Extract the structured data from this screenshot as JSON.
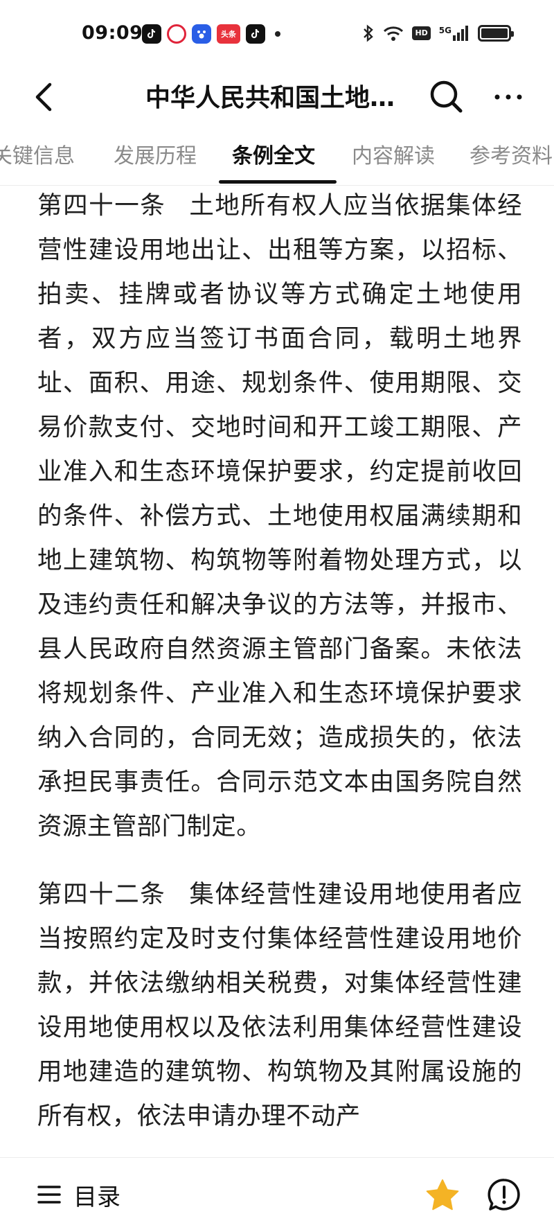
{
  "status_bar": {
    "time": "09:09",
    "toutiao_label": "头条",
    "hd_label": "HD",
    "network_label": "5G"
  },
  "header": {
    "title": "中华人民共和国土地…"
  },
  "tabs": [
    {
      "label": "关键信息",
      "active": false
    },
    {
      "label": "发展历程",
      "active": false
    },
    {
      "label": "条例全文",
      "active": true
    },
    {
      "label": "内容解读",
      "active": false
    },
    {
      "label": "参考资料",
      "active": false
    }
  ],
  "articles": [
    {
      "number": "第四十一条",
      "text": "土地所有权人应当依据集体经营性建设用地出让、出租等方案，以招标、拍卖、挂牌或者协议等方式确定土地使用者，双方应当签订书面合同，载明土地界址、面积、用途、规划条件、使用期限、交易价款支付、交地时间和开工竣工期限、产业准入和生态环境保护要求，约定提前收回的条件、补偿方式、土地使用权届满续期和地上建筑物、构筑物等附着物处理方式，以及违约责任和解决争议的方法等，并报市、县人民政府自然资源主管部门备案。未依法将规划条件、产业准入和生态环境保护要求纳入合同的，合同无效；造成损失的，依法承担民事责任。合同示范文本由国务院自然资源主管部门制定。"
    },
    {
      "number": "第四十二条",
      "text": "集体经营性建设用地使用者应当按照约定及时支付集体经营性建设用地价款，并依法缴纳相关税费，对集体经营性建设用地使用权以及依法利用集体经营性建设用地建造的建筑物、构筑物及其附属设施的所有权，依法申请办理不动产"
    }
  ],
  "bottom_bar": {
    "toc_label": "目录"
  },
  "colors": {
    "active_tab": "#111111",
    "inactive_tab": "#8a8a8a",
    "favorite_star": "#f4b325"
  }
}
